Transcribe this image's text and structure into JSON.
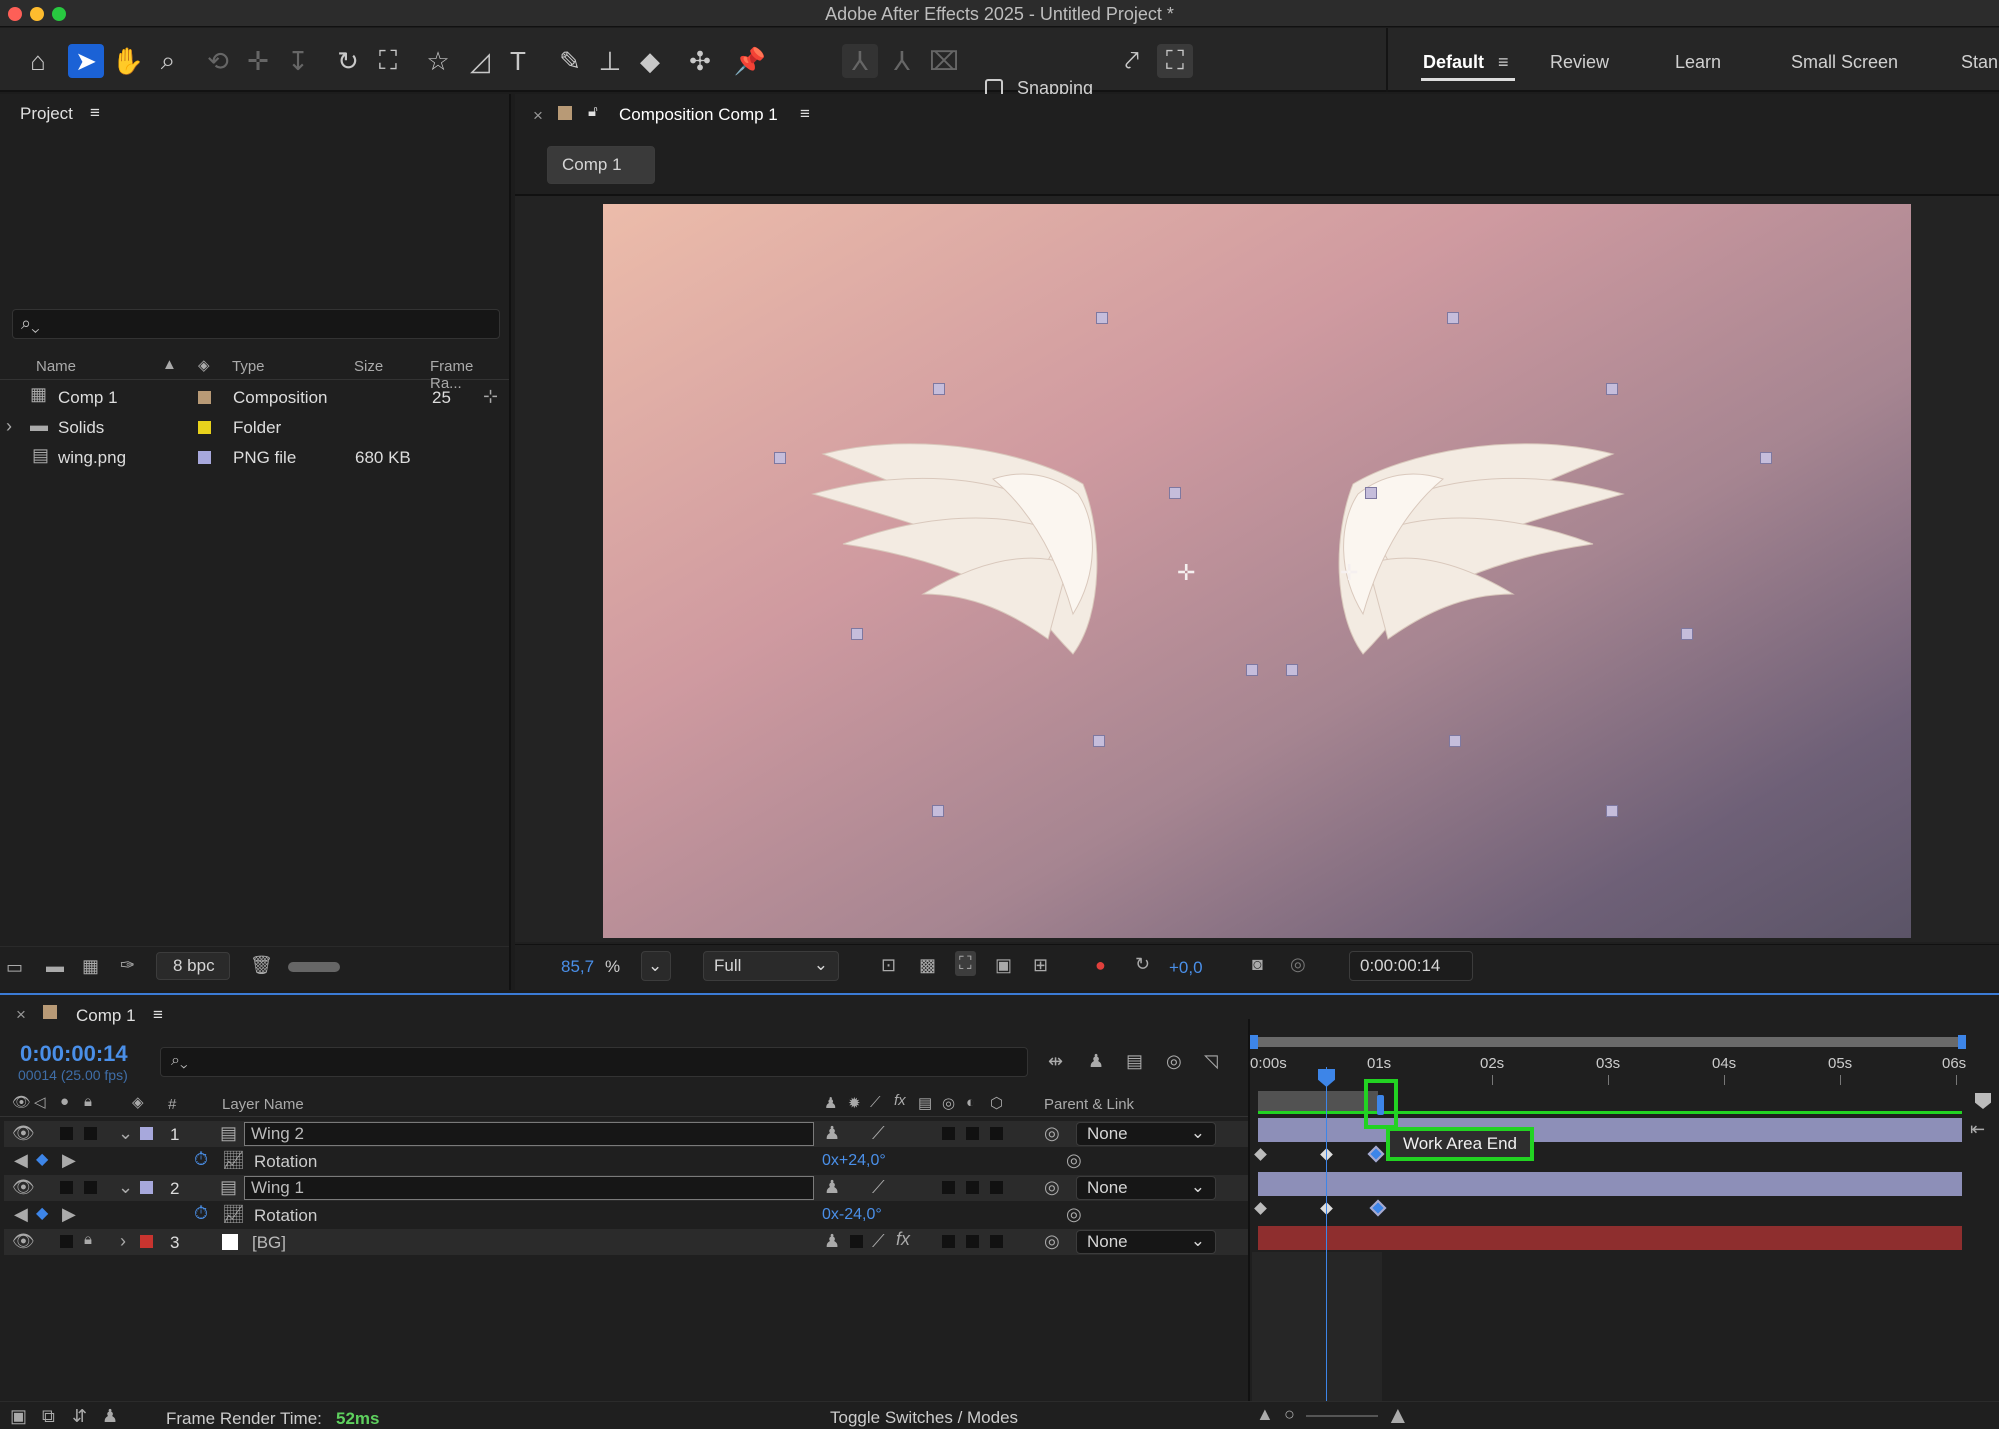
{
  "window": {
    "title": "Adobe After Effects 2025 - Untitled Project *"
  },
  "toolbar": {
    "tools": [
      "home-icon",
      "selection-arrow-icon",
      "hand-icon",
      "zoom-icon",
      "orbit-icon",
      "pan-icon",
      "dolly-icon",
      "rotate-icon",
      "pan-behind-icon",
      "star-shape-icon",
      "pen-icon",
      "type-icon",
      "brush-icon",
      "clone-stamp-icon",
      "eraser-icon",
      "roto-brush-icon",
      "puppet-pin-icon"
    ],
    "snapping_label": "Snapping",
    "workspaces": [
      "Default",
      "Review",
      "Learn",
      "Small Screen",
      "Stan"
    ],
    "active_workspace": "Default"
  },
  "project": {
    "title": "Project",
    "search_placeholder": "",
    "columns": {
      "name": "Name",
      "type": "Type",
      "size": "Size",
      "frame_rate": "Frame Ra..."
    },
    "items": [
      {
        "name": "Comp 1",
        "label_color": "#b89a76",
        "type": "Composition",
        "size": "",
        "frame_rate": "25",
        "icon": "composition-icon"
      },
      {
        "name": "Solids",
        "label_color": "#e8d21c",
        "type": "Folder",
        "size": "",
        "frame_rate": "",
        "icon": "folder-icon"
      },
      {
        "name": "wing.png",
        "label_color": "#a7a8dc",
        "type": "PNG file",
        "size": "680 KB",
        "frame_rate": "",
        "icon": "file-icon"
      }
    ],
    "bpc": "8 bpc"
  },
  "composition": {
    "tab_title": "Composition Comp 1",
    "crumb": "Comp 1",
    "zoom": "85,7",
    "zoom_unit": "%",
    "resolution": "Full",
    "exposure": "+0,0",
    "timecode": "0:00:00:14"
  },
  "timeline": {
    "tab_title": "Comp 1",
    "current_time": "0:00:00:14",
    "frame_info": "00014 (25.00 fps)",
    "col_number": "#",
    "col_layer_name": "Layer Name",
    "col_parent": "Parent & Link",
    "ruler": [
      "0:00s",
      "01s",
      "02s",
      "03s",
      "04s",
      "05s",
      "06s"
    ],
    "layers": [
      {
        "num": "1",
        "name": "Wing 2",
        "label_color": "#a7a8dc",
        "parent": "None",
        "property": "Rotation",
        "value": "0x+24,0°"
      },
      {
        "num": "2",
        "name": "Wing 1",
        "label_color": "#a7a8dc",
        "parent": "None",
        "property": "Rotation",
        "value": "0x-24,0°"
      },
      {
        "num": "3",
        "name": "[BG]",
        "label_color": "#c8342f",
        "parent": "None"
      }
    ],
    "tooltip": "Work Area End",
    "render_label": "Frame Render Time:",
    "render_value": "52ms",
    "toggle_label": "Toggle Switches / Modes"
  }
}
